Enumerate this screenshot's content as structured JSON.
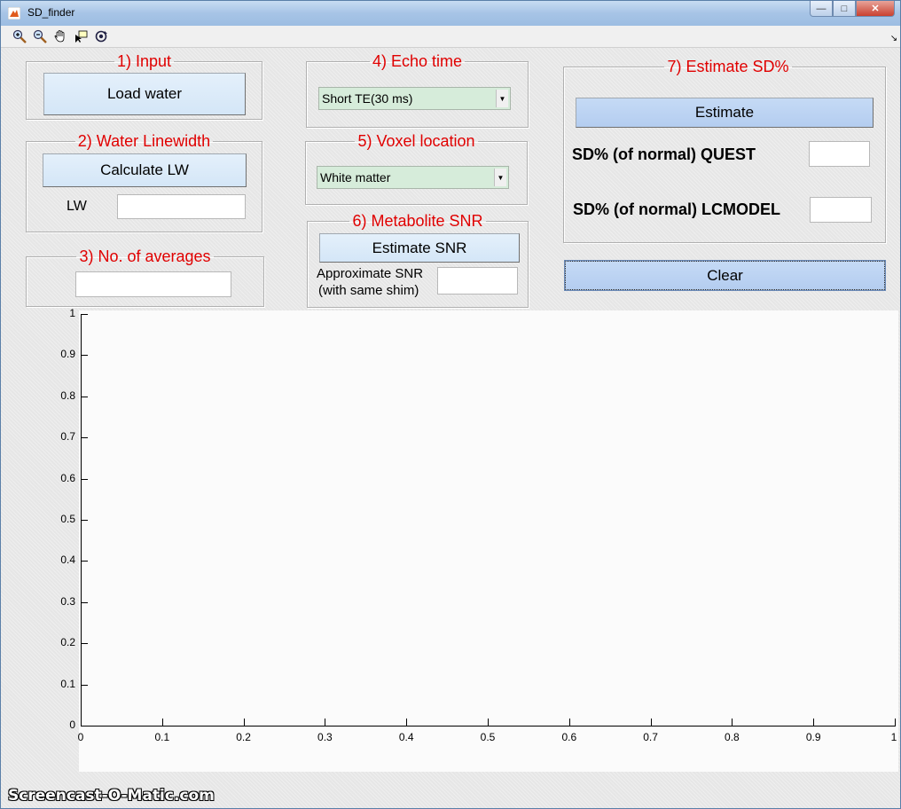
{
  "window": {
    "title": "SD_finder",
    "min_glyph": "—",
    "max_glyph": "□",
    "close_glyph": "✕"
  },
  "toolbar": {
    "icons": [
      "zoom-in-icon",
      "zoom-out-icon",
      "pan-hand-icon",
      "data-cursor-icon",
      "rotate-icon"
    ],
    "overflow_glyph": "↘"
  },
  "panels": {
    "input": {
      "legend": "1) Input",
      "load_label": "Load water"
    },
    "linewidth": {
      "legend": "2) Water Linewidth",
      "calc_label": "Calculate LW",
      "lw_label": "LW",
      "lw_value": ""
    },
    "averages": {
      "legend": "3) No. of averages",
      "value": ""
    },
    "echo": {
      "legend": "4) Echo time",
      "selected": "Short TE(30 ms)"
    },
    "voxel": {
      "legend": "5) Voxel location",
      "selected": "White matter"
    },
    "snr": {
      "legend": "6) Metabolite SNR",
      "estimate_label": "Estimate SNR",
      "approx_label_1": "Approximate SNR",
      "approx_label_2": "(with same shim)",
      "value": ""
    },
    "sd": {
      "legend": "7) Estimate SD%",
      "estimate_label": "Estimate",
      "quest_label": "SD% (of normal) QUEST",
      "quest_value": "",
      "lcmodel_label": "SD% (of normal) LCMODEL",
      "lcmodel_value": ""
    }
  },
  "clear_label": "Clear",
  "chart_data": {
    "type": "line",
    "series": [],
    "xlim": [
      0,
      1
    ],
    "ylim": [
      0,
      1
    ],
    "xticks": [
      "0",
      "0.1",
      "0.2",
      "0.3",
      "0.4",
      "0.5",
      "0.6",
      "0.7",
      "0.8",
      "0.9",
      "1"
    ],
    "yticks": [
      "0",
      "0.1",
      "0.2",
      "0.3",
      "0.4",
      "0.5",
      "0.6",
      "0.7",
      "0.8",
      "0.9",
      "1"
    ],
    "grid": false
  },
  "watermark": "Screencast-O-Matic.com"
}
